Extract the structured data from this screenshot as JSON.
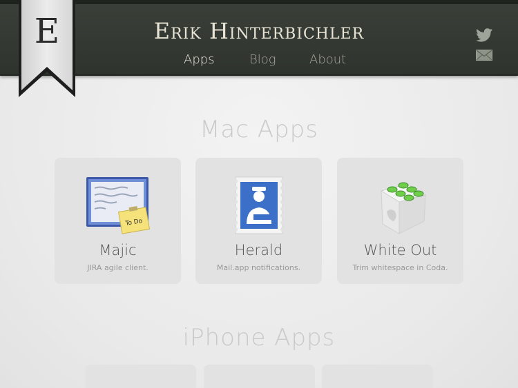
{
  "site": {
    "logo_letter": "E",
    "title": "Erik Hinterbichler"
  },
  "nav": {
    "items": [
      {
        "label": "Apps",
        "active": true
      },
      {
        "label": "Blog",
        "active": false
      },
      {
        "label": "About",
        "active": false
      }
    ]
  },
  "social": {
    "icons": [
      "twitter-icon",
      "mail-icon"
    ]
  },
  "sections": {
    "mac": {
      "heading": "Mac Apps",
      "apps": [
        {
          "name": "Majic",
          "description": "JIRA agile client.",
          "icon": "majic-app-icon",
          "icon_note": "To Do"
        },
        {
          "name": "Herald",
          "description": "Mail.app notifications.",
          "icon": "herald-app-icon"
        },
        {
          "name": "White Out",
          "description": "Trim whitespace in Coda.",
          "icon": "white-out-app-icon"
        }
      ]
    },
    "iphone": {
      "heading": "iPhone Apps"
    }
  },
  "colors": {
    "header_bg": "#353a33",
    "title_text": "#e8e4d6",
    "page_bg": "#ededed",
    "card_bg": "#e2e2e2",
    "heading_text": "#c9c9c9"
  }
}
